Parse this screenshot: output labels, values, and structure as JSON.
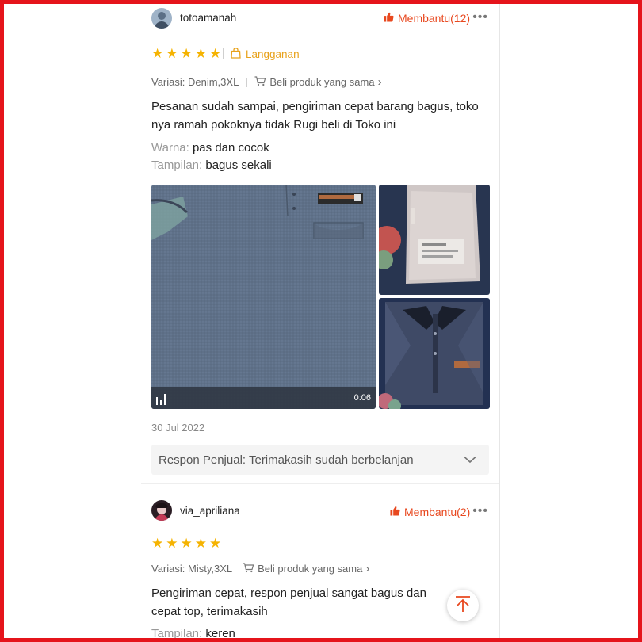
{
  "reviews": [
    {
      "username": "totoamanah",
      "helpful_label": "Membantu(12)",
      "more_label": "•••",
      "rating": 5,
      "subscription_label": "Langganan",
      "variant_label": "Variasi: Denim,3XL",
      "buy_same_label": "Beli produk yang sama",
      "text": "Pesanan sudah sampai, pengiriman cepat barang bagus, toko nya ramah pokoknya tidak Rugi beli di Toko ini",
      "attributes": [
        {
          "key": "Warna:",
          "value": "pas dan cocok"
        },
        {
          "key": "Tampilan:",
          "value": "bagus sekali"
        }
      ],
      "video_duration": "0:06",
      "date": "30 Jul 2022",
      "seller_response": "Respon Penjual: Terimakasih sudah berbelanjan"
    },
    {
      "username": "via_apriliana",
      "helpful_label": "Membantu(2)",
      "more_label": "•••",
      "rating": 5,
      "variant_label": "Variasi: Misty,3XL",
      "buy_same_label": "Beli produk yang sama",
      "text": "Pengiriman cepat, respon penjual sangat bagus dan cepat top, terimakasih",
      "attributes": [
        {
          "key": "Tampilan:",
          "value": "keren"
        }
      ]
    }
  ],
  "icons": {
    "star": "★",
    "chevron_right": "›",
    "thumbs_up": "thumbs-up-icon",
    "cart": "cart-icon",
    "bag": "shopping-bag-icon",
    "scroll_top": "arrow-up-icon"
  },
  "colors": {
    "accent": "#e8481f",
    "star": "#f5b301",
    "subscription": "#e8a21b",
    "frame": "#e5141b"
  }
}
